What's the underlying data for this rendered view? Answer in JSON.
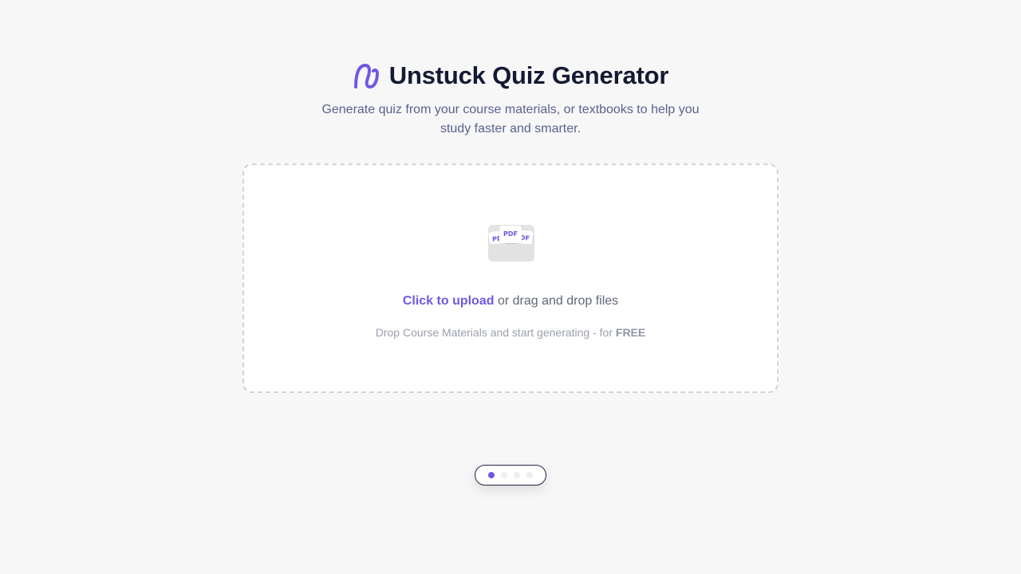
{
  "header": {
    "logo_icon": "unstuck-logo-icon",
    "title": "Unstuck Quiz Generator",
    "subtitle": "Generate quiz from your course materials, or textbooks to help you study faster and smarter."
  },
  "dropzone": {
    "icon": "pdf-files-folder-icon",
    "doc_labels": [
      "PDF",
      "PDF",
      "PDF"
    ],
    "upload_link": "Click to upload",
    "upload_rest": " or drag and drop files",
    "hint_text": "Drop Course Materials and start generating - for ",
    "hint_emphasis": "FREE"
  },
  "pager": {
    "total": 4,
    "active_index": 0
  },
  "colors": {
    "accent": "#7158e2",
    "title": "#141a33",
    "subtitle": "#5a6290",
    "background": "#f7f7f7"
  }
}
